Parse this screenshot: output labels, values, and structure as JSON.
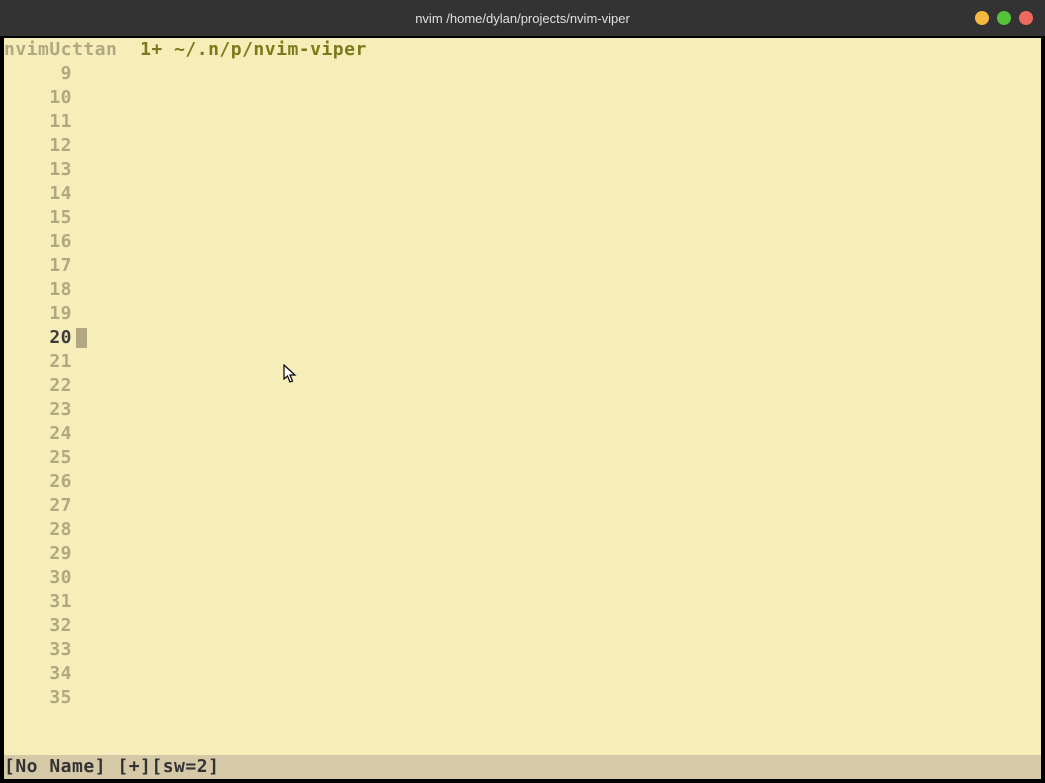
{
  "titlebar": {
    "text": "nvim /home/dylan/projects/nvim-viper"
  },
  "tabline": {
    "left": "nvimUcttan",
    "right": "1+ ~/.n/p/nvim-viper"
  },
  "gutter": {
    "start": 9,
    "end": 35,
    "current_line": 20
  },
  "statusline": "[No Name] [+][sw=2]"
}
